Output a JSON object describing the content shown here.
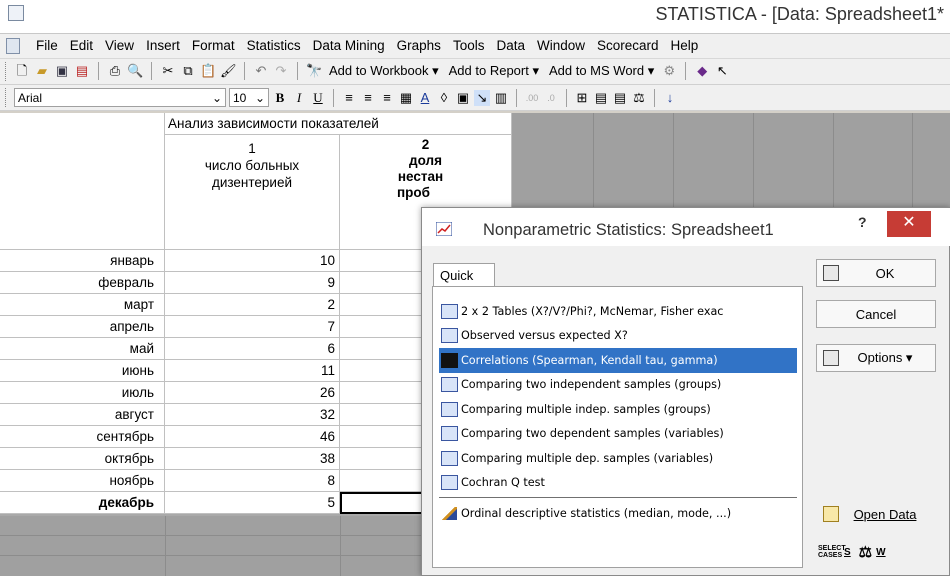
{
  "window": {
    "title": "STATISTICA - [Data: Spreadsheet1*"
  },
  "menu": [
    "File",
    "Edit",
    "View",
    "Insert",
    "Format",
    "Statistics",
    "Data Mining",
    "Graphs",
    "Tools",
    "Data",
    "Window",
    "Scorecard",
    "Help"
  ],
  "toolbar1": {
    "add_workbook": "Add to Workbook ▾",
    "add_report": "Add to Report ▾",
    "add_msword": "Add to MS Word ▾"
  },
  "toolbar2": {
    "font": "Arial",
    "size": "10"
  },
  "sheet": {
    "header_title": "Анализ зависимости показателей",
    "col1": {
      "num": "1",
      "label_line1": "число больных",
      "label_line2": "дизентерией"
    },
    "col2": {
      "num": "2",
      "label_line1": "доля",
      "label_line2": "нестан",
      "label_line3": "проб"
    },
    "rows": [
      {
        "label": "январь",
        "value": "10"
      },
      {
        "label": "февраль",
        "value": "9"
      },
      {
        "label": "март",
        "value": "2"
      },
      {
        "label": "апрель",
        "value": "7"
      },
      {
        "label": "май",
        "value": "6"
      },
      {
        "label": "июнь",
        "value": "11"
      },
      {
        "label": "июль",
        "value": "26"
      },
      {
        "label": "август",
        "value": "32"
      },
      {
        "label": "сентябрь",
        "value": "46"
      },
      {
        "label": "октябрь",
        "value": "38"
      },
      {
        "label": "ноябрь",
        "value": "8"
      },
      {
        "label": "декабрь",
        "value": "5"
      }
    ]
  },
  "dialog": {
    "title": "Nonparametric Statistics: Spreadsheet1",
    "help": "?",
    "close": "✕",
    "tab": "Quick",
    "items": [
      {
        "label": "2 x 2 Tables (X?/V?/Phi?, McNemar, Fisher exac",
        "selected": false
      },
      {
        "label": "Observed versus expected X?",
        "selected": false
      },
      {
        "label": "Correlations (Spearman, Kendall tau, gamma)",
        "selected": true
      },
      {
        "label": "Comparing two independent samples (groups)",
        "selected": false
      },
      {
        "label": "Comparing multiple indep. samples (groups)",
        "selected": false
      },
      {
        "label": "Comparing two dependent samples (variables)",
        "selected": false
      },
      {
        "label": "Comparing multiple dep. samples (variables)",
        "selected": false
      },
      {
        "label": "Cochran Q test",
        "selected": false
      }
    ],
    "extra_item": "Ordinal descriptive statistics (median, mode, ...)",
    "buttons": {
      "ok": "OK",
      "cancel": "Cancel",
      "options": "Options ▾",
      "open_data": "Open Data",
      "select_cases": "SELECT CASES",
      "select_cases_key": "S",
      "weights_key": "W"
    }
  },
  "colors": {
    "selected": "#3173c6",
    "close": "#c63c35"
  }
}
